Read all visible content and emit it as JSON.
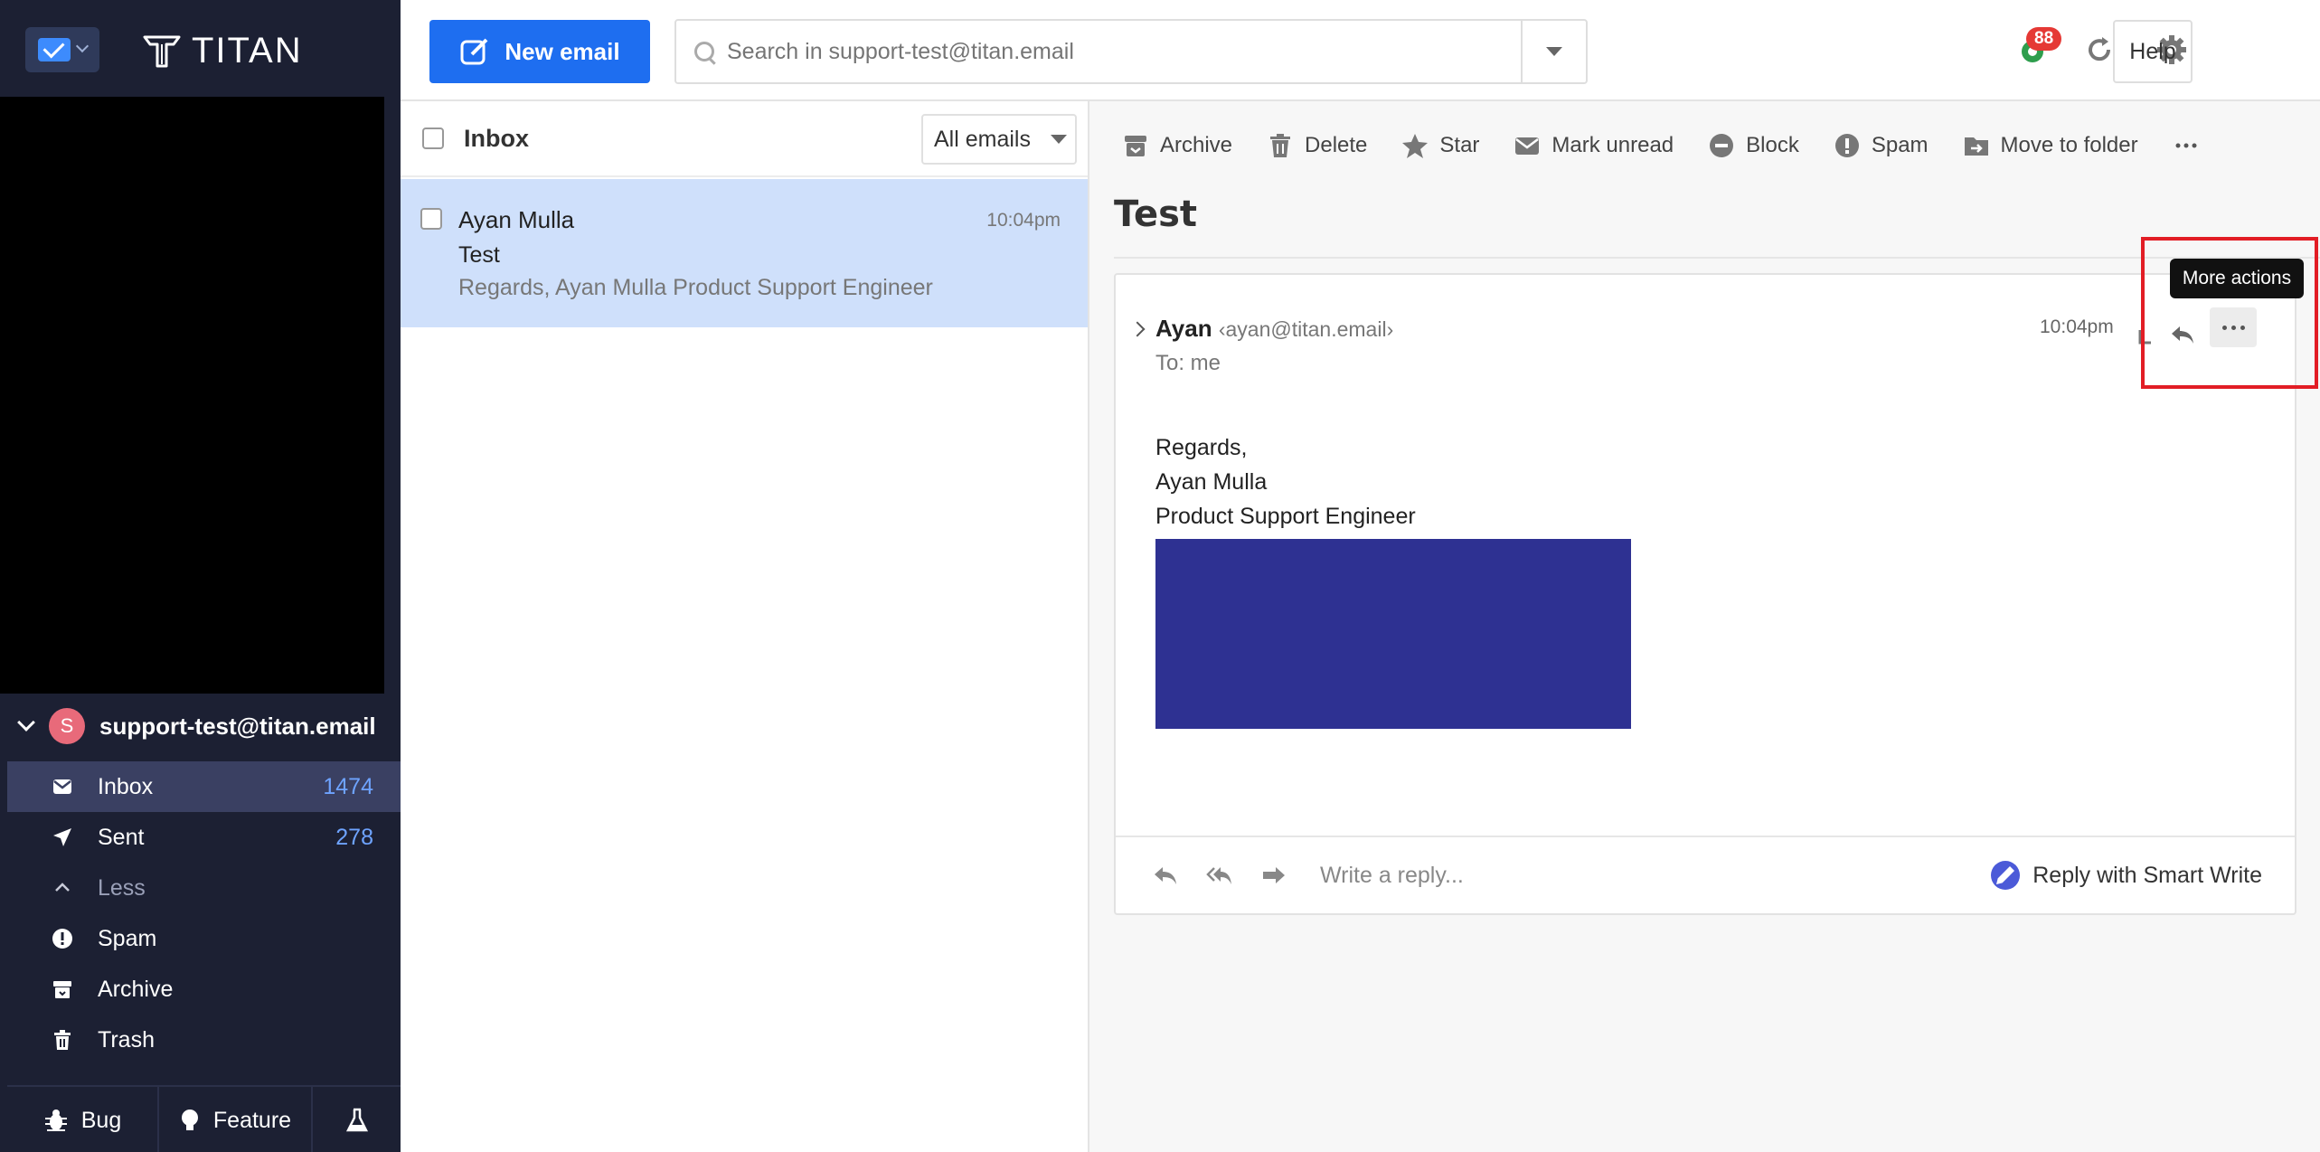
{
  "brand": {
    "name": "TITAN"
  },
  "header": {
    "new_email_label": "New email",
    "search_placeholder": "Search in support-test@titan.email",
    "notification_count": "88",
    "help_label": "Help"
  },
  "sidebar": {
    "account": {
      "initial": "S",
      "email": "support-test@titan.email"
    },
    "folders": [
      {
        "label": "Inbox",
        "count": "1474",
        "icon": "inbox-icon"
      },
      {
        "label": "Sent",
        "count": "278",
        "icon": "sent-icon"
      },
      {
        "label": "Less",
        "count": "",
        "icon": "chevron-up-icon"
      },
      {
        "label": "Spam",
        "count": "",
        "icon": "spam-icon"
      },
      {
        "label": "Archive",
        "count": "",
        "icon": "archive-icon"
      },
      {
        "label": "Trash",
        "count": "",
        "icon": "trash-icon"
      }
    ],
    "bottom": {
      "bug_label": "Bug",
      "feature_label": "Feature"
    }
  },
  "list": {
    "folder_title": "Inbox",
    "filter_label": "All emails",
    "messages": [
      {
        "sender": "Ayan Mulla",
        "time": "10:04pm",
        "subject": "Test",
        "preview": "Regards, Ayan Mulla Product  Support Engineer"
      }
    ]
  },
  "toolbar": {
    "archive": "Archive",
    "delete": "Delete",
    "star": "Star",
    "mark_unread": "Mark unread",
    "block": "Block",
    "spam": "Spam",
    "move_to_folder": "Move to folder"
  },
  "message": {
    "subject": "Test",
    "from_name": "Ayan",
    "from_addr": "‹ayan@titan.email›",
    "to": "To: me",
    "time": "10:04pm",
    "body_lines": [
      "Regards,",
      "Ayan Mulla",
      "Product  Support Engineer"
    ],
    "reply_placeholder": "Write a reply...",
    "smart_write_label": "Reply with Smart Write",
    "tooltip": "More actions"
  },
  "colors": {
    "sidebar_bg": "#1c2033",
    "accent": "#1e6ef0",
    "selected_row": "#cfe0fb",
    "banner": "#2e3192",
    "highlight": "#e21d25"
  }
}
